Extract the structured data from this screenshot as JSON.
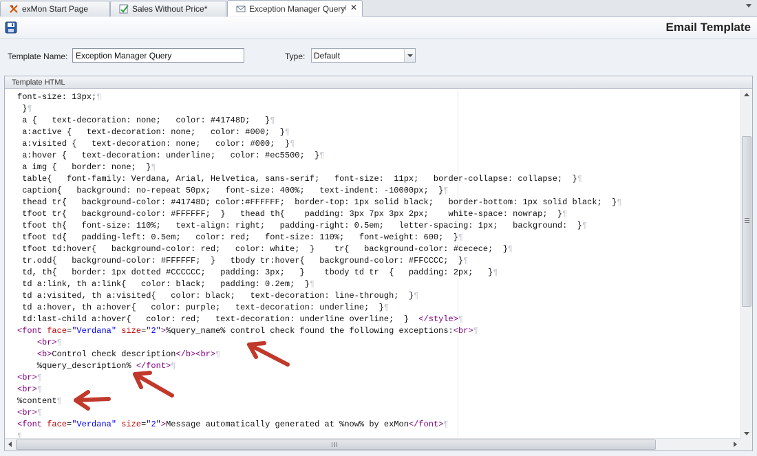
{
  "tabs": [
    {
      "label": "exMon Start Page",
      "icon": "exmon-logo-icon",
      "active": false
    },
    {
      "label": "Sales Without Price*",
      "icon": "check-document-icon",
      "active": false
    },
    {
      "label": "Exception Manager Query",
      "icon": "email-icon",
      "active": true
    }
  ],
  "header": {
    "title": "Email Template",
    "save_icon": "save-icon"
  },
  "form": {
    "template_name_label": "Template Name:",
    "template_name_value": "Exception Manager Query",
    "type_label": "Type:",
    "type_value": "Default"
  },
  "editor": {
    "group_label": "Template HTML",
    "pilcrow": "¶",
    "lines": [
      "font-size: 13px;",
      " }",
      " a {   text-decoration: none;   color: #41748D;   }",
      " a:active {   text-decoration: none;   color: #000;  }",
      " a:visited {   text-decoration: none;   color: #000;  }",
      " a:hover {   text-decoration: underline;   color: #ec5500;  }",
      " a img {   border: none;  }",
      " table{   font-family: Verdana, Arial, Helvetica, sans-serif;   font-size:  11px;   border-collapse: collapse;  }",
      " caption{   background: no-repeat 50px;   font-size: 400%;   text-indent: -10000px;  }",
      " thead tr{   background-color: #41748D; color:#FFFFFF;  border-top: 1px solid black;   border-bottom: 1px solid black;  }",
      " tfoot tr{   background-color: #FFFFFF;  }   thead th{    padding: 3px 7px 3px 2px;    white-space: nowrap;  }",
      " tfoot th{   font-size: 110%;   text-align: right;   padding-right: 0.5em;   letter-spacing: 1px;   background:  }",
      " tfoot td{   padding-left: 0.5em;   color: red;   font-size: 110%;   font-weight: 600;  }",
      " tfoot td:hover{   background-color: red;   color: white;  }    tr{   background-color: #cecece;  }",
      " tr.odd{   background-color: #FFFFFF;  }   tbody tr:hover{   background-color: #FFCCCC;  }",
      " td, th{   border: 1px dotted #CCCCCC;   padding: 3px;   }    tbody td tr  {   padding: 2px;   }",
      " td a:link, th a:link{   color: black;   padding: 0.2em;  }",
      " td a:visited, th a:visited{   color: black;   text-decoration: line-through;  }",
      " td a:hover, th a:hover{   color: purple;   text-decoration: underline;  }",
      " td:last-child a:hover{   color: red;   text-decoration: underline overline;  }  </style>",
      "<font face=\"Verdana\" size=\"2\">%query_name% control check found the following exceptions:<br>",
      "    <br>",
      "    <b>Control check description</b><br>",
      "    %query_description% </font>",
      "<br>",
      "<br>",
      "%content",
      "<br>",
      "<font face=\"Verdana\" size=\"2\">Message automatically generated at %now% by exMon</font>",
      ""
    ]
  },
  "annotations": {
    "arrow_color": "#c0392b"
  }
}
